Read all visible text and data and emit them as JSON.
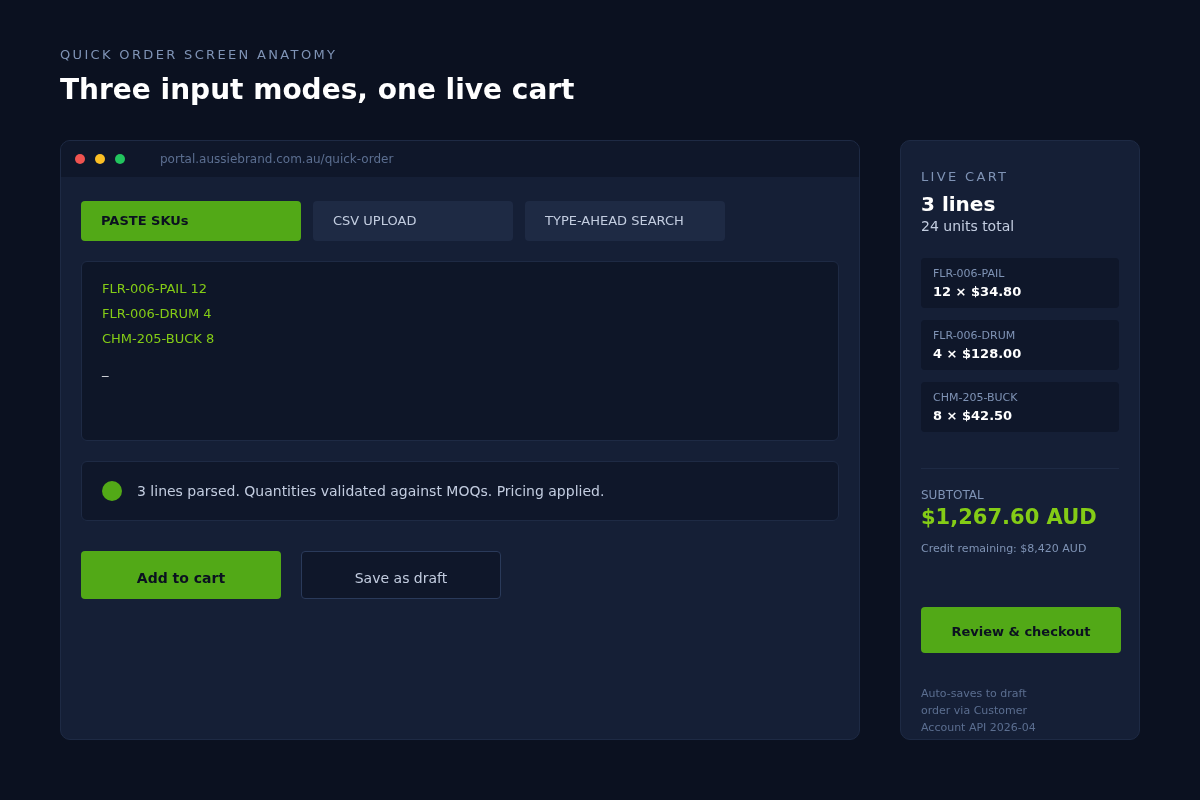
{
  "eyebrow": "QUICK ORDER SCREEN ANATOMY",
  "title": "Three input modes, one live cart",
  "browser": {
    "url": "portal.aussiebrand.com.au/quick-order"
  },
  "tabs": [
    {
      "label": "PASTE SKUs",
      "selected": true
    },
    {
      "label": "CSV UPLOAD",
      "selected": false
    },
    {
      "label": "TYPE-AHEAD SEARCH",
      "selected": false
    }
  ],
  "paste_box": {
    "lines": [
      "FLR-006-PAIL 12",
      "FLR-006-DRUM 4",
      "CHM-205-BUCK 8"
    ],
    "cursor": "_"
  },
  "status": {
    "message": "3 lines parsed. Quantities validated against MOQs. Pricing applied.",
    "color": "#52a917"
  },
  "buttons": [
    {
      "label": "Add to cart",
      "kind": "primary"
    },
    {
      "label": "Save as draft",
      "kind": "secondary"
    }
  ],
  "cart": {
    "heading": "LIVE CART",
    "lines_count": "3 lines",
    "units": "24 units total",
    "items": [
      {
        "sku": "FLR-006-PAIL",
        "qty_price": "12 × $34.80"
      },
      {
        "sku": "FLR-006-DRUM",
        "qty_price": "4 × $128.00"
      },
      {
        "sku": "CHM-205-BUCK",
        "qty_price": "8 × $42.50"
      }
    ],
    "subtotal_label": "SUBTOTAL",
    "subtotal": "$1,267.60 AUD",
    "credit": "Credit remaining: $8,420 AUD",
    "checkout": "Review & checkout",
    "footnote": "Auto-saves to draft order via Customer Account API 2026-04"
  }
}
